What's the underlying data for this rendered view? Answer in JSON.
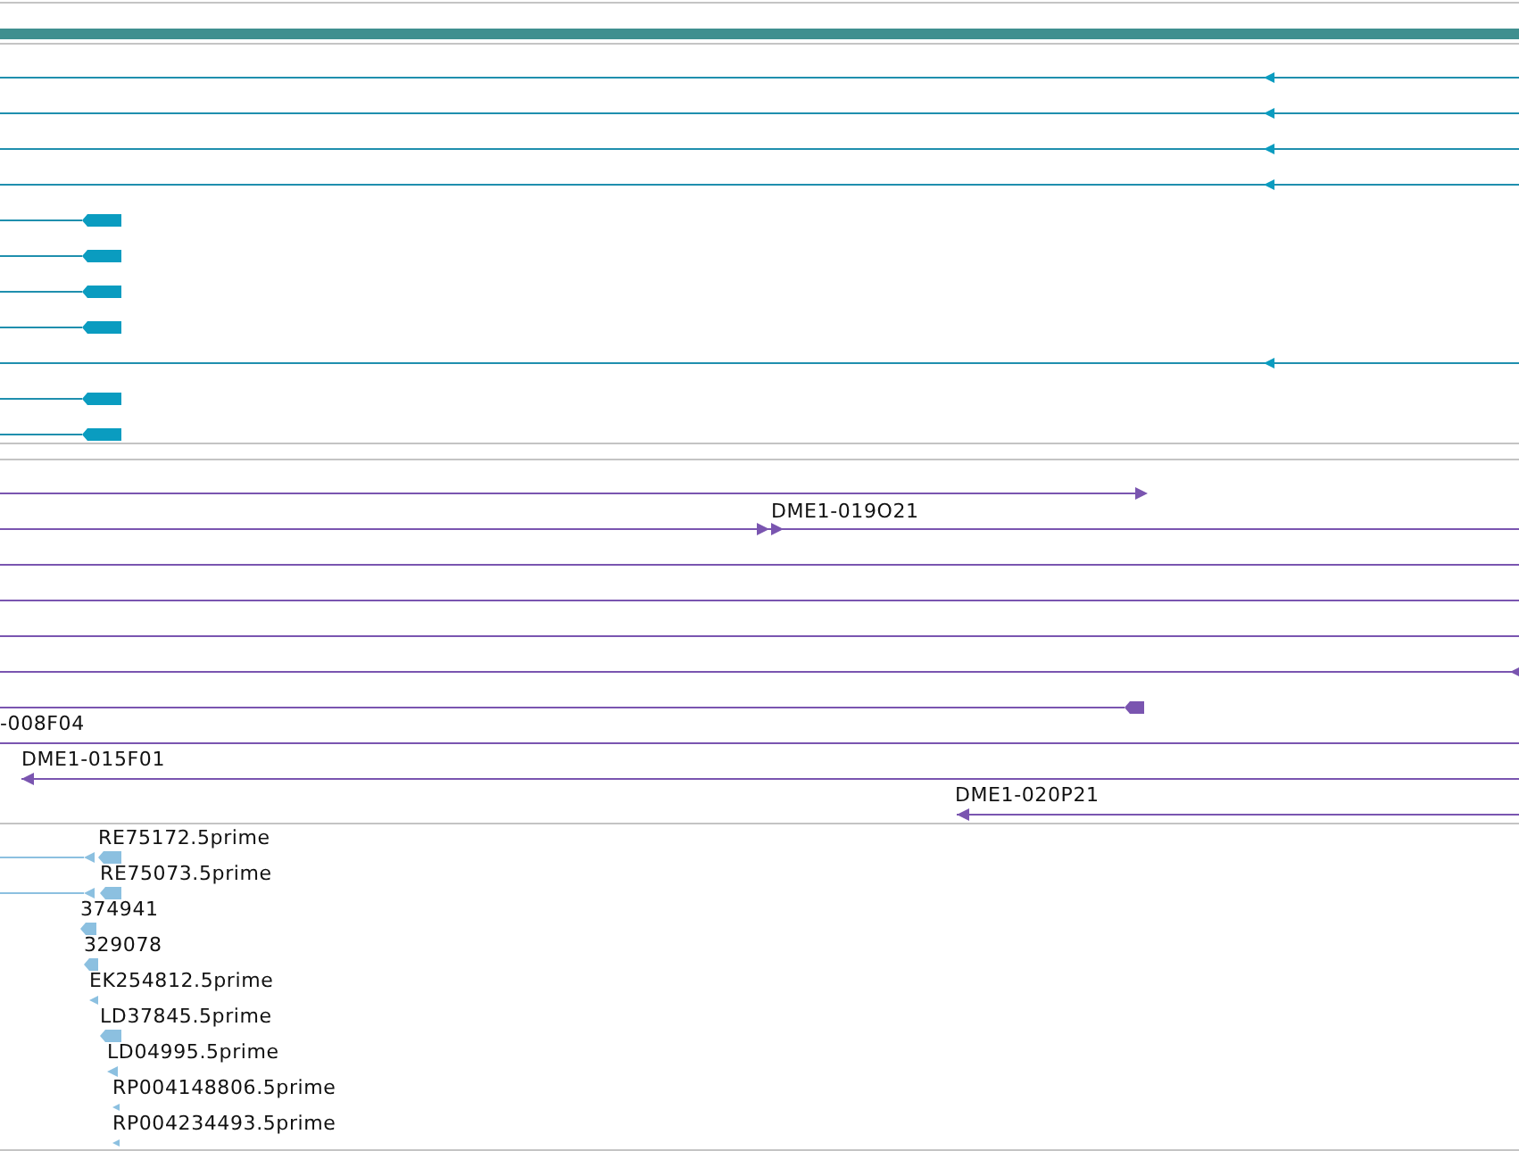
{
  "tracks": [
    {
      "kind": "gene",
      "features": [
        {
          "kind": "arrow",
          "reverse": true
        },
        {
          "kind": "arrow",
          "reverse": true
        },
        {
          "kind": "arrow",
          "reverse": true
        },
        {
          "kind": "arrow",
          "reverse": true
        },
        {
          "kind": "block",
          "reverse": true
        },
        {
          "kind": "block",
          "reverse": true
        },
        {
          "kind": "block",
          "reverse": true
        },
        {
          "kind": "block",
          "reverse": true
        },
        {
          "kind": "arrow",
          "reverse": true
        },
        {
          "kind": "block",
          "reverse": true
        },
        {
          "kind": "block",
          "reverse": true
        }
      ]
    },
    {
      "kind": "clone",
      "features": [
        {
          "kind": "arrow",
          "reverse": false
        },
        {
          "kind": "arrow",
          "reverse": false,
          "label": "DME1-019O21"
        },
        {
          "kind": "span"
        },
        {
          "kind": "span"
        },
        {
          "kind": "span"
        },
        {
          "kind": "arrow",
          "reverse": true
        },
        {
          "kind": "block",
          "reverse": true
        },
        {
          "kind": "span",
          "label": "-008F04"
        },
        {
          "kind": "arrow",
          "reverse": true,
          "label": "DME1-015F01"
        },
        {
          "kind": "arrow",
          "reverse": true,
          "label": "DME1-020P21"
        }
      ]
    },
    {
      "kind": "est",
      "features": [
        {
          "kind": "block",
          "reverse": true,
          "label": "RE75172.5prime"
        },
        {
          "kind": "block",
          "reverse": true,
          "label": "RE75073.5prime"
        },
        {
          "kind": "block",
          "reverse": true,
          "label": "374941"
        },
        {
          "kind": "block",
          "reverse": true,
          "label": "329078"
        },
        {
          "kind": "arrow",
          "reverse": true,
          "label": "EK254812.5prime"
        },
        {
          "kind": "block",
          "reverse": true,
          "label": "LD37845.5prime"
        },
        {
          "kind": "arrow",
          "reverse": true,
          "label": "LD04995.5prime"
        },
        {
          "kind": "arrow",
          "reverse": true,
          "label": "RP004148806.5prime"
        },
        {
          "kind": "arrow",
          "reverse": true,
          "label": "RP004234493.5prime"
        }
      ]
    }
  ]
}
